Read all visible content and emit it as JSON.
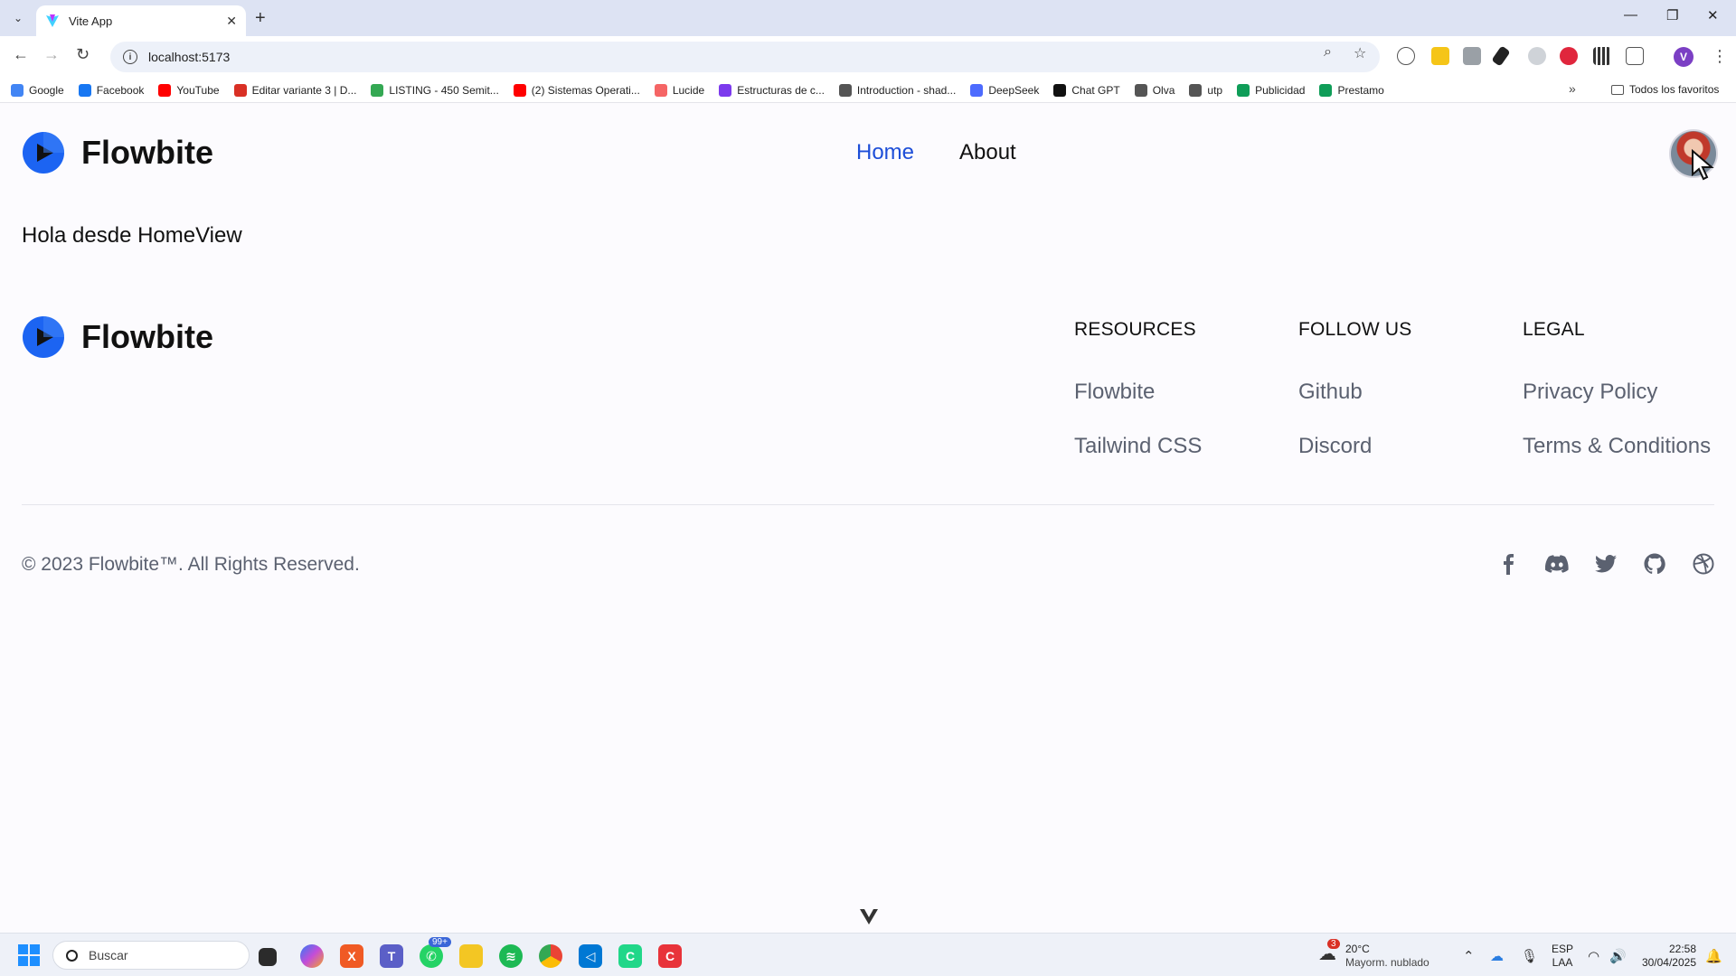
{
  "browser": {
    "tab_title": "Vite App",
    "url": "localhost:5173",
    "profile_initial": "V",
    "bookmarks": [
      {
        "label": "Google",
        "color": "#4285f4"
      },
      {
        "label": "Facebook",
        "color": "#1877f2"
      },
      {
        "label": "YouTube",
        "color": "#ff0000"
      },
      {
        "label": "Editar variante 3 | D...",
        "color": "#d93025"
      },
      {
        "label": "LISTING - 450 Semit...",
        "color": "#34a853"
      },
      {
        "label": "(2) Sistemas Operati...",
        "color": "#ff0000"
      },
      {
        "label": "Lucide",
        "color": "#f56565"
      },
      {
        "label": "Estructuras de c...",
        "color": "#7c3aed"
      },
      {
        "label": "Introduction - shad...",
        "color": "#555555"
      },
      {
        "label": "DeepSeek",
        "color": "#4d6bfe"
      },
      {
        "label": "Chat GPT",
        "color": "#111111"
      },
      {
        "label": "Olva",
        "color": "#555555"
      },
      {
        "label": "utp",
        "color": "#555555"
      },
      {
        "label": "Publicidad",
        "color": "#0f9d58"
      },
      {
        "label": "Prestamo",
        "color": "#0f9d58"
      }
    ],
    "all_bookmarks_label": "Todos los favoritos"
  },
  "header": {
    "brand": "Flowbite",
    "nav": [
      {
        "label": "Home",
        "active": true
      },
      {
        "label": "About",
        "active": false
      }
    ]
  },
  "main": {
    "greeting": "Hola desde HomeView"
  },
  "footer": {
    "brand": "Flowbite",
    "columns": [
      {
        "heading": "RESOURCES",
        "links": [
          "Flowbite",
          "Tailwind CSS"
        ]
      },
      {
        "heading": "FOLLOW US",
        "links": [
          "Github",
          "Discord"
        ]
      },
      {
        "heading": "LEGAL",
        "links": [
          "Privacy Policy",
          "Terms & Conditions"
        ]
      }
    ],
    "copyright": "© 2023 Flowbite™. All Rights Reserved.",
    "social_icons": [
      "facebook-icon",
      "discord-icon",
      "twitter-icon",
      "github-icon",
      "dribbble-icon"
    ]
  },
  "taskbar": {
    "search_placeholder": "Buscar",
    "whatsapp_badge": "99+",
    "weather_badge": "3",
    "weather_temp": "20°C",
    "weather_desc": "Mayorm. nublado",
    "lang_top": "ESP",
    "lang_bottom": "LAA",
    "time": "22:58",
    "date": "30/04/2025"
  },
  "colors": {
    "accent": "#1d4ed8",
    "link_gray": "#5b6170"
  }
}
